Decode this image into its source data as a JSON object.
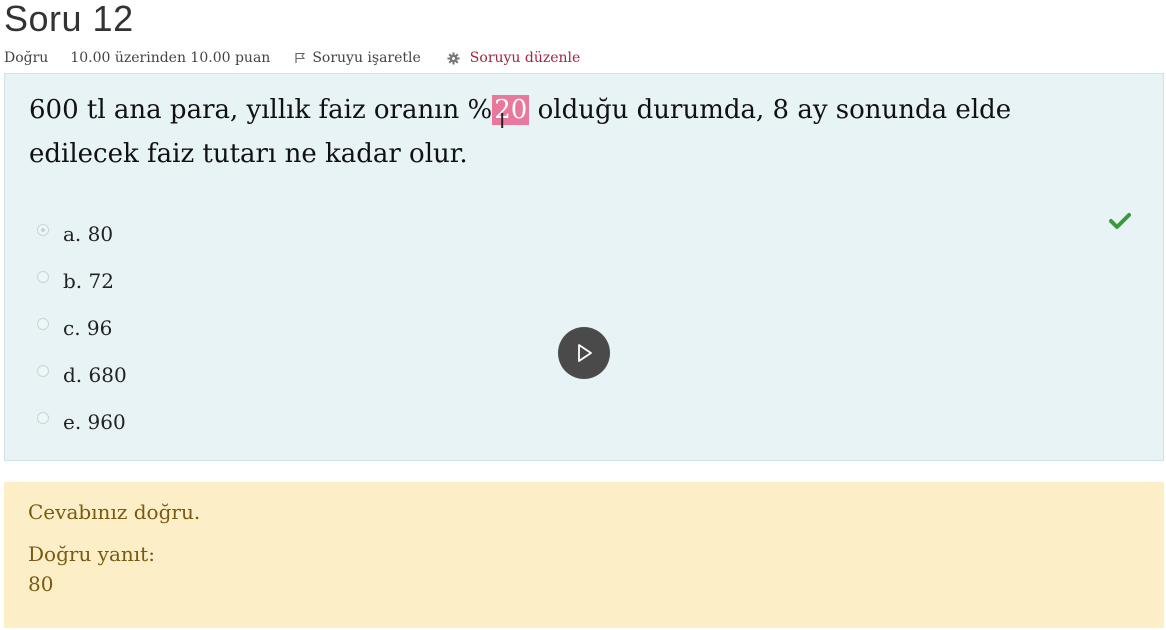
{
  "question": {
    "title": "Soru 12",
    "state": "Doğru",
    "grade": "10.00 üzerinden 10.00 puan",
    "flag_label": "Soruyu işaretle",
    "edit_label": "Soruyu düzenle",
    "text_before": "600 tl ana para, yıllık faiz oranın %",
    "text_highlight": "20",
    "text_after": " olduğu durumda, 8 ay sonunda elde edilecek faiz tutarı ne kadar olur."
  },
  "answers": [
    {
      "label": "a. 80",
      "selected": true,
      "correct": true
    },
    {
      "label": "b. 72",
      "selected": false
    },
    {
      "label": "c. 96",
      "selected": false
    },
    {
      "label": "d. 680",
      "selected": false
    },
    {
      "label": "e. 960",
      "selected": false
    }
  ],
  "feedback": {
    "message": "Cevabınız doğru.",
    "right_answer_label": "Doğru yanıt:",
    "right_answer": "80"
  },
  "colors": {
    "question_bg": "#e7f3f5",
    "feedback_bg": "#fcefc7",
    "highlight": "#e8799c",
    "check": "#3a9a3a",
    "edit_link": "#a0253f"
  },
  "icons": {
    "flag": "flag-icon",
    "edit": "gear-icon",
    "correct": "check-icon",
    "video": "play-icon"
  }
}
